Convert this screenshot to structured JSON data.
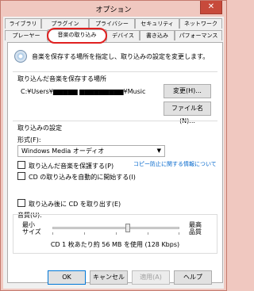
{
  "window": {
    "title": "オプション",
    "close_icon": "✕"
  },
  "tabs": {
    "row1": [
      {
        "label": "ライブラリ"
      },
      {
        "label": "プラグイン"
      },
      {
        "label": "プライバシー"
      },
      {
        "label": "セキュリティ"
      },
      {
        "label": "ネットワーク"
      }
    ],
    "row2": [
      {
        "label": "プレーヤー"
      },
      {
        "label": "音楽の取り込み",
        "selected": true
      },
      {
        "label": "デバイス"
      },
      {
        "label": "書き込み"
      },
      {
        "label": "パフォーマンス"
      }
    ]
  },
  "panel": {
    "description": "音楽を保存する場所を指定し、取り込みの設定を変更します。",
    "save_location": {
      "label": "取り込んだ音楽を保存する場所",
      "path": "C:¥Users¥▆▆▆▆▆ ▆▆▆▆▆▆▆▆▆¥Music",
      "change_button": "変更(H)...",
      "filename_button": "ファイル名(N)..."
    },
    "rip_settings": {
      "label": "取り込みの設定",
      "format_label": "形式(F):",
      "format_value": "Windows Media オーディオ",
      "copy_protect": "取り込んだ音楽を保護する(P)",
      "copy_protect_link": "コピー防止に関する情報について",
      "auto_rip": "CD の取り込みを自動的に開始する(I)",
      "eject": "取り込み後に CD を取り出す(E)"
    },
    "quality": {
      "label": "音質(U):",
      "min_label": "最小\nサイズ",
      "max_label": "最高\n品質",
      "level": 0.6,
      "summary": "CD 1 枚あたり約 56 MB を使用 (128 Kbps)"
    }
  },
  "footer": {
    "ok": "OK",
    "cancel": "キャンセル",
    "apply": "適用(A)",
    "help": "ヘルプ"
  },
  "colors": {
    "frame": "#f0c8c0",
    "close": "#c74a3b",
    "link": "#0066cc",
    "highlight_ring": "#e02020"
  }
}
